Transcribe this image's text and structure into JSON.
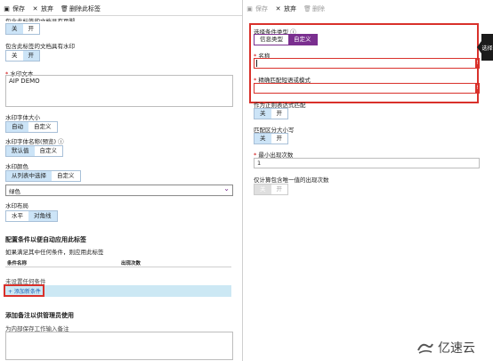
{
  "left": {
    "toolbar": {
      "save": "保存",
      "discard": "放弃",
      "delete_label": "删除此标签"
    },
    "partial_label": "包含此标签的文档具有页脚",
    "toggle1": {
      "off": "关",
      "on": "开"
    },
    "watermark_label": "包含此标签的文档具有水印",
    "toggle2": {
      "off": "关",
      "on": "开"
    },
    "watermark_text_label": "水印文本",
    "watermark_text_value": "AIP DEMO",
    "font_size_label": "水印字体大小",
    "font_size_opts": {
      "auto": "自动",
      "custom": "自定义"
    },
    "font_name_label": "水印字体名称(预览)",
    "font_name_opts": {
      "default": "默认值",
      "custom": "自定义"
    },
    "color_label": "水印颜色",
    "color_opts": {
      "list": "从列表中选择",
      "custom": "自定义"
    },
    "color_value": "绿色",
    "layout_label": "水印布局",
    "layout_opts": {
      "horizontal": "水平",
      "diagonal": "对角线"
    },
    "auto_section": "配置条件以便自动应用此标签",
    "auto_desc": "如果满足其中任何条件，则应用此标签",
    "table_headers": {
      "name": "条件名称",
      "count": "出现次数"
    },
    "no_conditions": "未设置任何条件",
    "add_condition": "+ 添加新条件",
    "notes_section": "添加备注以供管理员使用",
    "notes_placeholder": "为内部保存工作输入备注"
  },
  "right": {
    "toolbar": {
      "save": "保存",
      "discard": "放弃",
      "delete": "删除"
    },
    "cond_type_label": "选择条件类型",
    "cond_type_opts": {
      "info": "信息类型",
      "custom": "自定义"
    },
    "name_label": "名称",
    "match_label": "精确匹配短语或模式",
    "regex_label": "作为正则表达式匹配",
    "regex_opts": {
      "off": "关",
      "on": "开"
    },
    "case_label": "匹配区分大小写",
    "case_opts": {
      "off": "关",
      "on": "开"
    },
    "min_label": "最小出现次数",
    "min_value": "1",
    "unique_label": "仅计算包含唯一值的出现次数",
    "unique_opts": {
      "off": "关",
      "on": "开"
    },
    "edge_tab": "选择"
  },
  "watermark": "亿速云"
}
